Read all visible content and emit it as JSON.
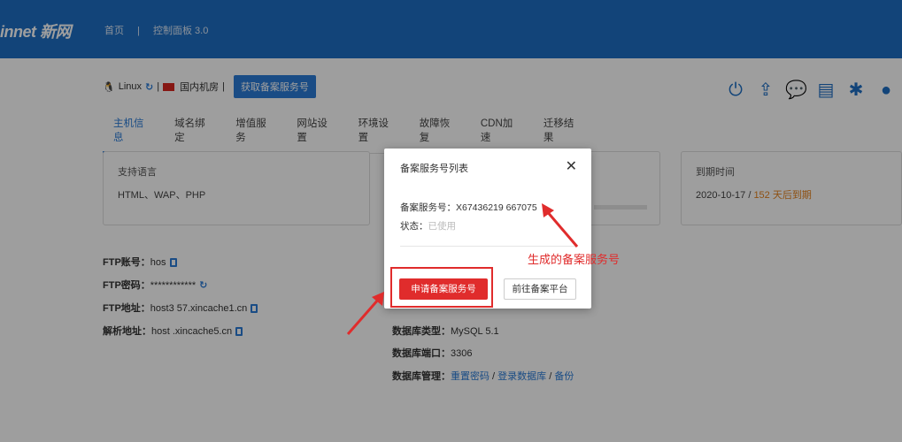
{
  "header": {
    "logo": "innet 新网",
    "nav": [
      "首页",
      "|",
      "控制面板 3.0"
    ]
  },
  "toolbar": {
    "os": "Linux",
    "sep": "|",
    "region": "国内机房",
    "fetch_button": "获取备案服务号"
  },
  "tabs": [
    "主机信息",
    "域名绑定",
    "增值服务",
    "网站设置",
    "环境设置",
    "故障恢复",
    "CDN加速",
    "迁移结果"
  ],
  "cards": {
    "lang_title": "支持语言",
    "lang_value": "HTML、WAP、PHP",
    "expire_title": "到期时间",
    "expire_date": "2020-10-17 / ",
    "expire_due": "152 天后到期"
  },
  "info_left": [
    {
      "label": "FTP账号：",
      "value": "hos"
    },
    {
      "label": "FTP密码：",
      "value": "************"
    },
    {
      "label": "FTP地址：",
      "value": "host3  57.xincache1.cn"
    },
    {
      "label": "解析地址：",
      "value": "host  .xincache5.cn"
    }
  ],
  "info_right": {
    "db_type_label": "数据库类型：",
    "db_type_value": "MySQL 5.1",
    "db_port_label": "数据库端口：",
    "db_port_value": "3306",
    "db_manage_label": "数据库管理：",
    "db_reset": "重置密码",
    "db_login": "登录数据库",
    "db_backup": "备份",
    "slash": " / "
  },
  "modal": {
    "title": "备案服务号列表",
    "close": "✕",
    "service_label": "备案服务号：",
    "service_value": "X67436219  667075",
    "status_label": "状态：",
    "status_value": "已使用",
    "apply_button": "申请备案服务号",
    "goto_button": "前往备案平台"
  },
  "annotation": "生成的备案服务号",
  "colors": {
    "brand": "#1d6fc4",
    "accent": "#2a7bd7",
    "danger": "#e02c2c",
    "warn": "#e6821e"
  }
}
